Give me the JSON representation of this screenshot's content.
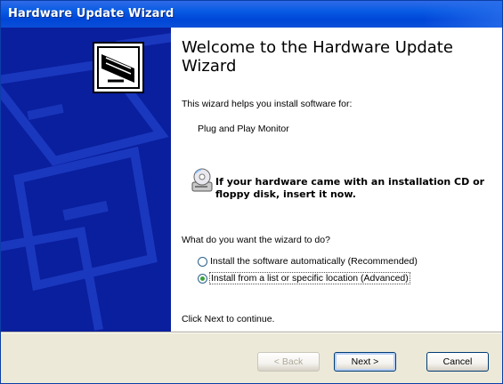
{
  "window": {
    "title": "Hardware Update Wizard"
  },
  "content": {
    "heading": "Welcome to the Hardware Update Wizard",
    "intro": "This wizard helps you install software for:",
    "device": "Plug and Play Monitor",
    "cd_prompt": "If your hardware came with an installation CD or floppy disk, insert it now.",
    "question": "What do you want the wizard to do?",
    "options": [
      {
        "label": "Install the software automatically (Recommended)",
        "selected": false
      },
      {
        "label": "Install from a list or specific location (Advanced)",
        "selected": true
      }
    ],
    "continue_hint": "Click Next to continue."
  },
  "buttons": {
    "back": "< Back",
    "next": "Next >",
    "cancel": "Cancel"
  },
  "icons": {
    "header": "hardware-card-icon",
    "cd": "cd-drive-icon"
  },
  "colors": {
    "titlebar": "#0a5de4",
    "sidebar": "#0a1f9e",
    "radio_selected": "#3ba33b"
  }
}
